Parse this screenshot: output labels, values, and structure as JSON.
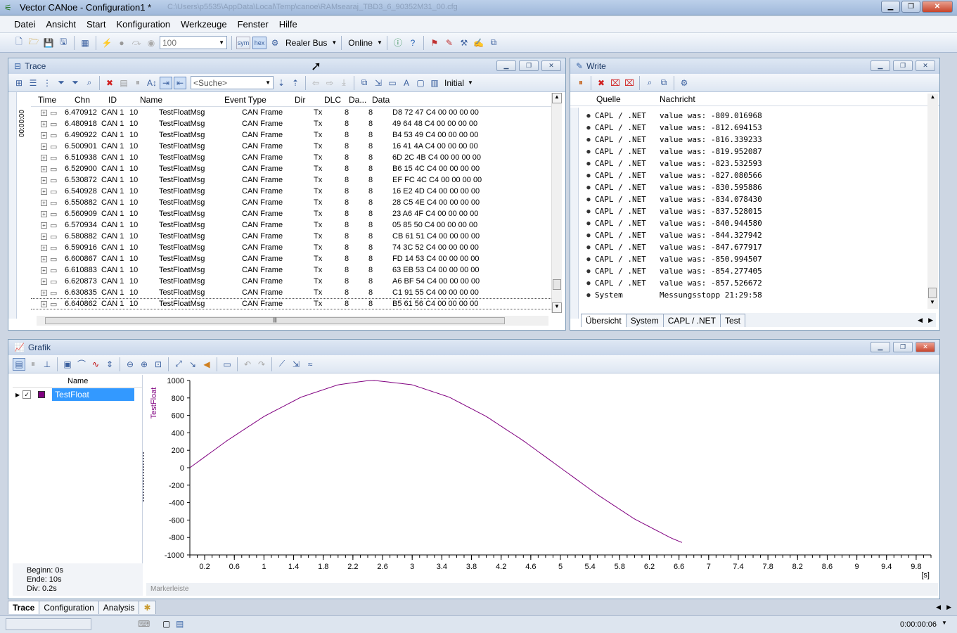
{
  "window": {
    "title": "Vector CANoe  - Configuration1 *",
    "path": "C:\\Users\\p5535\\AppData\\Local\\Temp\\canoe\\RAMsearaj_TBD3_6_90352M31_00.cfg",
    "buttons": {
      "minimize": "▁",
      "maximize": "❐",
      "close": "✕"
    }
  },
  "menu": [
    "Datei",
    "Ansicht",
    "Start",
    "Konfiguration",
    "Werkzeuge",
    "Fenster",
    "Hilfe"
  ],
  "toolbar": {
    "zoom_value": "100",
    "sym_label": "sym",
    "hex_label": "hex",
    "bus_label": "Realer Bus",
    "online_label": "Online"
  },
  "trace": {
    "title": "Trace",
    "search_placeholder": "<Suche>",
    "initial_label": "Initial",
    "side_time": "00:00:00",
    "columns": [
      "Time",
      "Chn",
      "ID",
      "Name",
      "Event Type",
      "Dir",
      "DLC",
      "Da...",
      "Data"
    ],
    "rows": [
      {
        "time": "6.470912",
        "chn": "CAN 1",
        "id": "10",
        "name": "TestFloatMsg",
        "evt": "CAN Frame",
        "dir": "Tx",
        "dlc": "8",
        "da": "8",
        "data": "D8 72 47 C4 00 00 00 00"
      },
      {
        "time": "6.480918",
        "chn": "CAN 1",
        "id": "10",
        "name": "TestFloatMsg",
        "evt": "CAN Frame",
        "dir": "Tx",
        "dlc": "8",
        "da": "8",
        "data": "49 64 48 C4 00 00 00 00"
      },
      {
        "time": "6.490922",
        "chn": "CAN 1",
        "id": "10",
        "name": "TestFloatMsg",
        "evt": "CAN Frame",
        "dir": "Tx",
        "dlc": "8",
        "da": "8",
        "data": "B4 53 49 C4 00 00 00 00"
      },
      {
        "time": "6.500901",
        "chn": "CAN 1",
        "id": "10",
        "name": "TestFloatMsg",
        "evt": "CAN Frame",
        "dir": "Tx",
        "dlc": "8",
        "da": "8",
        "data": "16 41 4A C4 00 00 00 00"
      },
      {
        "time": "6.510938",
        "chn": "CAN 1",
        "id": "10",
        "name": "TestFloatMsg",
        "evt": "CAN Frame",
        "dir": "Tx",
        "dlc": "8",
        "da": "8",
        "data": "6D 2C 4B C4 00 00 00 00"
      },
      {
        "time": "6.520900",
        "chn": "CAN 1",
        "id": "10",
        "name": "TestFloatMsg",
        "evt": "CAN Frame",
        "dir": "Tx",
        "dlc": "8",
        "da": "8",
        "data": "B6 15 4C C4 00 00 00 00"
      },
      {
        "time": "6.530872",
        "chn": "CAN 1",
        "id": "10",
        "name": "TestFloatMsg",
        "evt": "CAN Frame",
        "dir": "Tx",
        "dlc": "8",
        "da": "8",
        "data": "EF FC 4C C4 00 00 00 00"
      },
      {
        "time": "6.540928",
        "chn": "CAN 1",
        "id": "10",
        "name": "TestFloatMsg",
        "evt": "CAN Frame",
        "dir": "Tx",
        "dlc": "8",
        "da": "8",
        "data": "16 E2 4D C4 00 00 00 00"
      },
      {
        "time": "6.550882",
        "chn": "CAN 1",
        "id": "10",
        "name": "TestFloatMsg",
        "evt": "CAN Frame",
        "dir": "Tx",
        "dlc": "8",
        "da": "8",
        "data": "28 C5 4E C4 00 00 00 00"
      },
      {
        "time": "6.560909",
        "chn": "CAN 1",
        "id": "10",
        "name": "TestFloatMsg",
        "evt": "CAN Frame",
        "dir": "Tx",
        "dlc": "8",
        "da": "8",
        "data": "23 A6 4F C4 00 00 00 00"
      },
      {
        "time": "6.570934",
        "chn": "CAN 1",
        "id": "10",
        "name": "TestFloatMsg",
        "evt": "CAN Frame",
        "dir": "Tx",
        "dlc": "8",
        "da": "8",
        "data": "05 85 50 C4 00 00 00 00"
      },
      {
        "time": "6.580882",
        "chn": "CAN 1",
        "id": "10",
        "name": "TestFloatMsg",
        "evt": "CAN Frame",
        "dir": "Tx",
        "dlc": "8",
        "da": "8",
        "data": "CB 61 51 C4 00 00 00 00"
      },
      {
        "time": "6.590916",
        "chn": "CAN 1",
        "id": "10",
        "name": "TestFloatMsg",
        "evt": "CAN Frame",
        "dir": "Tx",
        "dlc": "8",
        "da": "8",
        "data": "74 3C 52 C4 00 00 00 00"
      },
      {
        "time": "6.600867",
        "chn": "CAN 1",
        "id": "10",
        "name": "TestFloatMsg",
        "evt": "CAN Frame",
        "dir": "Tx",
        "dlc": "8",
        "da": "8",
        "data": "FD 14 53 C4 00 00 00 00"
      },
      {
        "time": "6.610883",
        "chn": "CAN 1",
        "id": "10",
        "name": "TestFloatMsg",
        "evt": "CAN Frame",
        "dir": "Tx",
        "dlc": "8",
        "da": "8",
        "data": "63 EB 53 C4 00 00 00 00"
      },
      {
        "time": "6.620873",
        "chn": "CAN 1",
        "id": "10",
        "name": "TestFloatMsg",
        "evt": "CAN Frame",
        "dir": "Tx",
        "dlc": "8",
        "da": "8",
        "data": "A6 BF 54 C4 00 00 00 00"
      },
      {
        "time": "6.630835",
        "chn": "CAN 1",
        "id": "10",
        "name": "TestFloatMsg",
        "evt": "CAN Frame",
        "dir": "Tx",
        "dlc": "8",
        "da": "8",
        "data": "C1 91 55 C4 00 00 00 00"
      },
      {
        "time": "6.640862",
        "chn": "CAN 1",
        "id": "10",
        "name": "TestFloatMsg",
        "evt": "CAN Frame",
        "dir": "Tx",
        "dlc": "8",
        "da": "8",
        "data": "B5 61 56 C4 00 00 00 00"
      }
    ]
  },
  "write": {
    "title": "Write",
    "columns": [
      "Quelle",
      "Nachricht"
    ],
    "rows": [
      {
        "src": "CAPL / .NET",
        "msg": "value was: -809.016968"
      },
      {
        "src": "CAPL / .NET",
        "msg": "value was: -812.694153"
      },
      {
        "src": "CAPL / .NET",
        "msg": "value was: -816.339233"
      },
      {
        "src": "CAPL / .NET",
        "msg": "value was: -819.952087"
      },
      {
        "src": "CAPL / .NET",
        "msg": "value was: -823.532593"
      },
      {
        "src": "CAPL / .NET",
        "msg": "value was: -827.080566"
      },
      {
        "src": "CAPL / .NET",
        "msg": "value was: -830.595886"
      },
      {
        "src": "CAPL / .NET",
        "msg": "value was: -834.078430"
      },
      {
        "src": "CAPL / .NET",
        "msg": "value was: -837.528015"
      },
      {
        "src": "CAPL / .NET",
        "msg": "value was: -840.944580"
      },
      {
        "src": "CAPL / .NET",
        "msg": "value was: -844.327942"
      },
      {
        "src": "CAPL / .NET",
        "msg": "value was: -847.677917"
      },
      {
        "src": "CAPL / .NET",
        "msg": "value was: -850.994507"
      },
      {
        "src": "CAPL / .NET",
        "msg": "value was: -854.277405"
      },
      {
        "src": "CAPL / .NET",
        "msg": "value was: -857.526672"
      },
      {
        "src": "System",
        "msg": "Messungsstopp 21:29:58"
      }
    ],
    "tabs": [
      "Übersicht",
      "System",
      "CAPL / .NET",
      "Test"
    ]
  },
  "grafik": {
    "title": "Grafik",
    "name_header": "Name",
    "signal_name": "TestFloat",
    "signal_color": "#800080",
    "beginn": "Beginn: 0s",
    "ende": "Ende: 10s",
    "div": "Div: 0.2s",
    "markerleiste": "Markerleiste",
    "unit": "[s]"
  },
  "chart_data": {
    "type": "line",
    "ylabel": "TestFloat",
    "xlabel": "[s]",
    "xlim": [
      0,
      10
    ],
    "ylim": [
      -1000,
      1000
    ],
    "yticks": [
      1000,
      800,
      600,
      400,
      200,
      0,
      -200,
      -400,
      -600,
      -800,
      -1000
    ],
    "xticks": [
      0.2,
      0.6,
      1,
      1.4,
      1.8,
      2.2,
      2.6,
      3,
      3.4,
      3.8,
      4.2,
      4.6,
      5,
      5.4,
      5.8,
      6.2,
      6.6,
      7,
      7.4,
      7.8,
      8.2,
      8.6,
      9,
      9.4,
      9.8
    ],
    "series": [
      {
        "name": "TestFloat",
        "color": "#800080",
        "x": [
          0,
          0.5,
          1.0,
          1.5,
          2.0,
          2.4,
          2.5,
          3.0,
          3.5,
          4.0,
          4.5,
          5.0,
          5.5,
          6.0,
          6.5,
          6.64
        ],
        "y": [
          0,
          309,
          588,
          809,
          951,
          998,
          1000,
          951,
          809,
          588,
          309,
          0,
          -309,
          -588,
          -809,
          -857
        ]
      }
    ]
  },
  "bottom_tabs": [
    "Trace",
    "Configuration",
    "Analysis"
  ],
  "status": {
    "time": "0:00:00:06"
  }
}
